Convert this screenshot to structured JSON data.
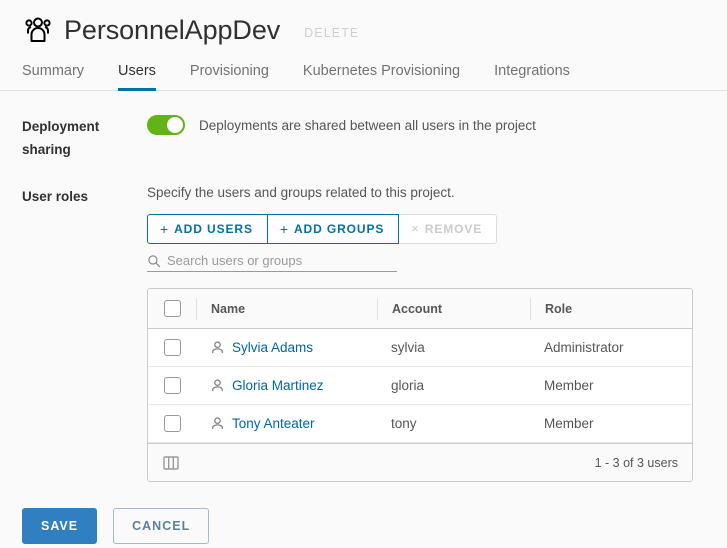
{
  "header": {
    "icon": "users-group-icon",
    "title": "PersonnelAppDev",
    "delete_label": "DELETE"
  },
  "tabs": [
    {
      "label": "Summary",
      "active": false
    },
    {
      "label": "Users",
      "active": true
    },
    {
      "label": "Provisioning",
      "active": false
    },
    {
      "label": "Kubernetes Provisioning",
      "active": false
    },
    {
      "label": "Integrations",
      "active": false
    }
  ],
  "deployment_sharing": {
    "label": "Deployment sharing",
    "toggle_on": true,
    "description": "Deployments are shared between all users in the project"
  },
  "user_roles": {
    "label": "User roles",
    "hint": "Specify the users and groups related to this project.",
    "buttons": {
      "add_users": "ADD USERS",
      "add_groups": "ADD GROUPS",
      "remove": "REMOVE",
      "plus_glyph": "+",
      "x_glyph": "×"
    },
    "search": {
      "placeholder": "Search users or groups",
      "value": "",
      "icon": "search-icon"
    },
    "table": {
      "columns": [
        "Name",
        "Account",
        "Role"
      ],
      "rows": [
        {
          "name": "Sylvia Adams",
          "account": "sylvia",
          "role": "Administrator"
        },
        {
          "name": "Gloria Martinez",
          "account": "gloria",
          "role": "Member"
        },
        {
          "name": "Tony Anteater",
          "account": "tony",
          "role": "Member"
        }
      ],
      "footer_count": "1 - 3 of 3 users",
      "footer_icon": "column-picker-icon"
    }
  },
  "footer": {
    "save_label": "SAVE",
    "cancel_label": "CANCEL"
  },
  "colors": {
    "accent_blue": "#0072a3",
    "link_blue": "#0065ab",
    "primary_button": "#307fc1",
    "toggle_green": "#60b515"
  }
}
